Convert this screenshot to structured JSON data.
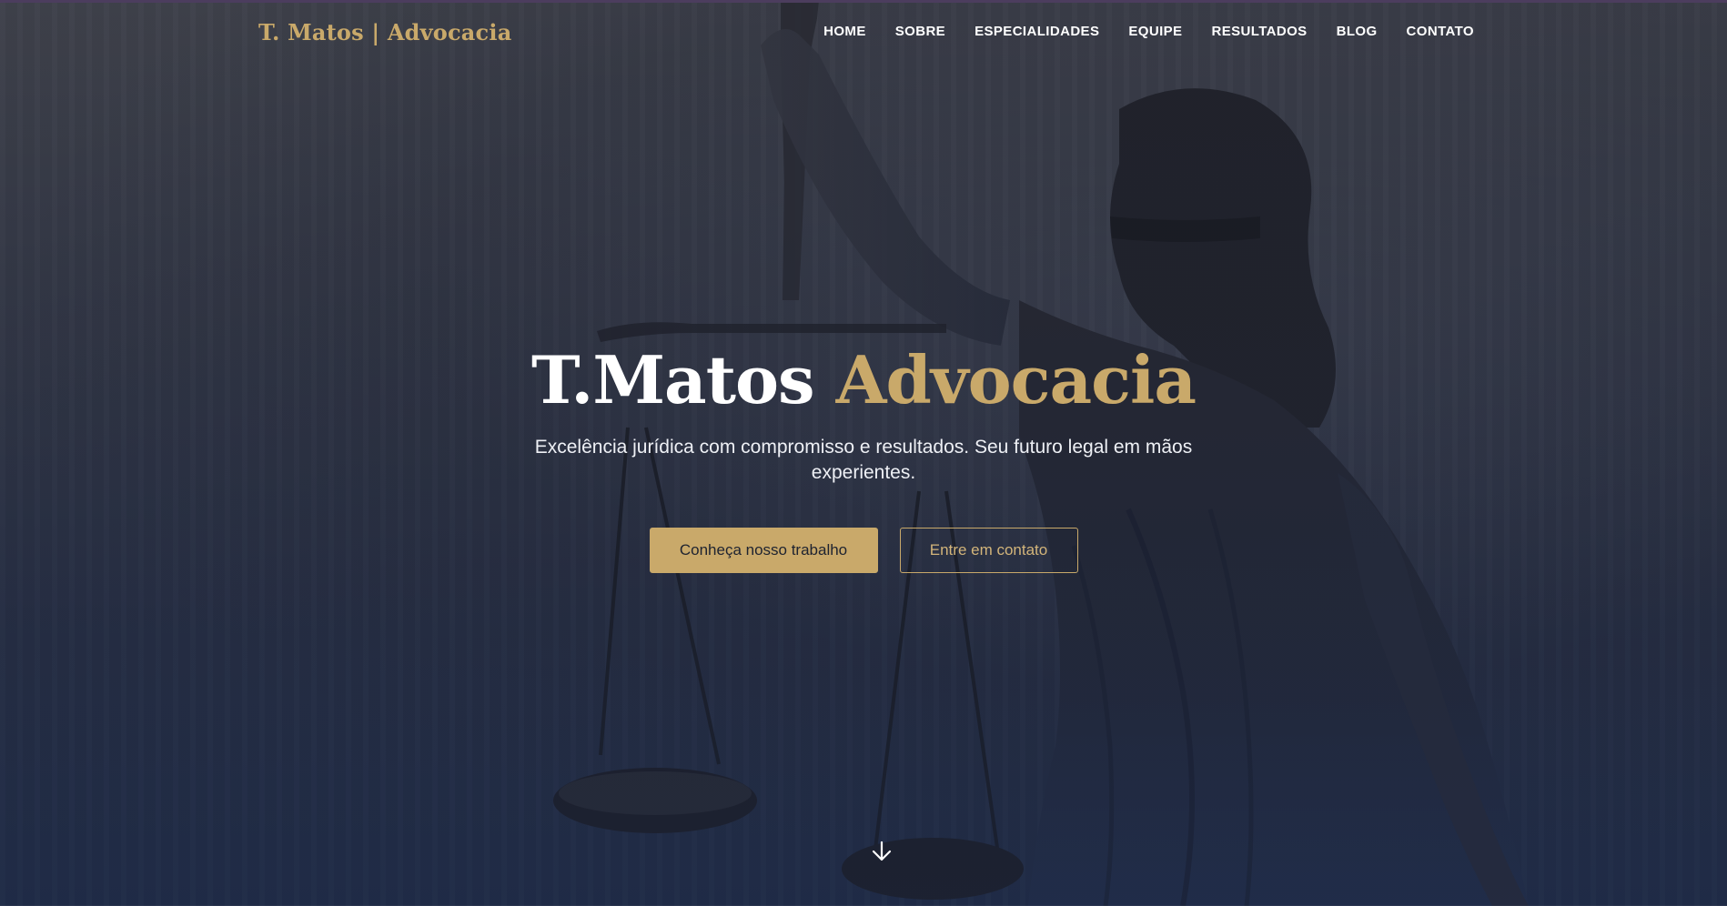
{
  "brand": {
    "logo": "T. Matos | Advocacia",
    "accent_color": "#c9a96a"
  },
  "nav": {
    "items": [
      {
        "label": "HOME"
      },
      {
        "label": "SOBRE"
      },
      {
        "label": "ESPECIALIDADES"
      },
      {
        "label": "EQUIPE"
      },
      {
        "label": "RESULTADOS"
      },
      {
        "label": "BLOG"
      },
      {
        "label": "CONTATO"
      }
    ]
  },
  "hero": {
    "title_main": "T.Matos",
    "title_accent": "Advocacia",
    "subtitle": "Excelência jurídica com compromisso e resultados. Seu futuro legal em mãos experientes.",
    "primary_button": "Conheça nosso trabalho",
    "secondary_button": "Entre em contato",
    "background_image": "lady-justice-statue",
    "scroll_icon": "arrow-down-icon"
  }
}
